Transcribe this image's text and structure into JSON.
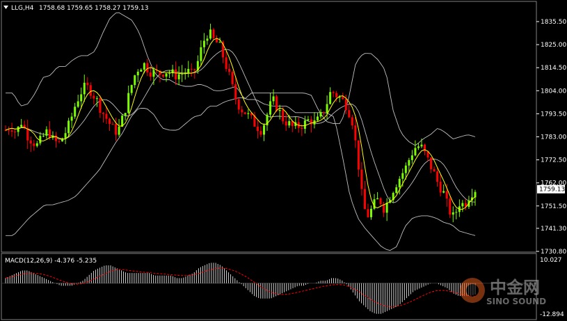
{
  "header": {
    "symbol_tf": "LLG,H4",
    "ohlc": "1758.68 1759.65 1758.27 1759.13"
  },
  "price_axis": {
    "ticks": [
      "1835.50",
      "1825.00",
      "1814.50",
      "1804.00",
      "1793.50",
      "1783.00",
      "1772.50",
      "1762.00",
      "1751.50",
      "1741.30",
      "1730.80"
    ],
    "current_price_label": "1759.13"
  },
  "macd": {
    "label": "MACD(12,26,9) -4.376 -5.235",
    "top_label": "10.027",
    "bottom_label": "-12.894"
  },
  "watermark": {
    "cn": "中金网",
    "en": "SINO SOUND"
  },
  "colors": {
    "background": "#000000",
    "bull": "#7CFC00",
    "bear": "#FF0000",
    "ma": "#FFFF00",
    "bollinger": "#C0C0C0",
    "macd_hist": "#FFFFFF",
    "macd_signal": "#FF0000",
    "current_price_bg": "#FFFFFF"
  },
  "chart_data": [
    {
      "type": "candlestick",
      "symbol": "LLG",
      "timeframe": "H4",
      "ylim": [
        1730.8,
        1840.0
      ],
      "current_price": 1759.13,
      "close_path": [
        1786,
        1788,
        1785,
        1790,
        1784,
        1781,
        1779,
        1783,
        1786,
        1781,
        1780,
        1784,
        1789,
        1797,
        1803,
        1806,
        1804,
        1800,
        1795,
        1791,
        1787,
        1785,
        1792,
        1801,
        1810,
        1815,
        1816,
        1813,
        1812,
        1812,
        1813,
        1812,
        1811,
        1812,
        1813,
        1811,
        1817,
        1826,
        1831,
        1827,
        1825,
        1818,
        1810,
        1801,
        1796,
        1794,
        1791,
        1788,
        1786,
        1793,
        1800,
        1796,
        1791,
        1789,
        1787,
        1788,
        1789,
        1791,
        1789,
        1792,
        1797,
        1804,
        1802,
        1800,
        1797,
        1790,
        1773,
        1751,
        1747,
        1752,
        1755,
        1750,
        1756,
        1761,
        1765,
        1769,
        1775,
        1779,
        1778,
        1773,
        1768,
        1762,
        1758,
        1750,
        1746,
        1753,
        1752,
        1757,
        1759.13
      ],
      "bollinger_upper_path": [
        1803,
        1803,
        1797,
        1798,
        1803,
        1810,
        1811,
        1815,
        1815,
        1818,
        1820,
        1820,
        1822,
        1830,
        1837,
        1840,
        1838,
        1836,
        1830,
        1820,
        1812,
        1809,
        1809,
        1807,
        1806,
        1806,
        1807,
        1806,
        1804,
        1804,
        1805,
        1806,
        1800,
        1803,
        1803,
        1803,
        1803,
        1803,
        1803,
        1803,
        1803,
        1802,
        1795,
        1790,
        1789,
        1789,
        1800,
        1817,
        1821,
        1821,
        1818,
        1813,
        1795,
        1785,
        1781,
        1779,
        1782,
        1784,
        1787,
        1785,
        1782,
        1783,
        1784,
        1783
      ],
      "bollinger_lower_path": [
        1738,
        1738,
        1742,
        1746,
        1749,
        1752,
        1752,
        1753,
        1754,
        1756,
        1760,
        1764,
        1768,
        1774,
        1780,
        1785,
        1792,
        1796,
        1796,
        1793,
        1787,
        1786,
        1786,
        1789,
        1792,
        1793,
        1797,
        1797,
        1799,
        1800,
        1801,
        1800,
        1800,
        1798,
        1797,
        1797,
        1797,
        1794,
        1794,
        1794,
        1794,
        1794,
        1792,
        1775,
        1756,
        1746,
        1741,
        1737,
        1733,
        1731,
        1733,
        1742,
        1746,
        1747,
        1747,
        1746,
        1744,
        1743,
        1740,
        1739,
        1738
      ]
    },
    {
      "type": "bar",
      "name": "MACD(12,26,9)",
      "ylim": [
        -12.894,
        10.027
      ],
      "macd_last": -4.376,
      "signal_last": -5.235,
      "macd_path": [
        2,
        3,
        4,
        5,
        5,
        4,
        3,
        2,
        1,
        0,
        -1,
        -1,
        -1,
        0,
        1,
        3,
        5,
        6,
        7,
        7,
        6,
        5,
        4,
        4,
        4,
        4,
        4,
        3,
        3,
        3,
        3,
        2,
        2,
        3,
        4,
        6,
        7,
        8,
        8,
        7,
        5,
        3,
        1,
        -1,
        -3,
        -5,
        -6,
        -6,
        -6,
        -5,
        -4,
        -3,
        -2,
        -1,
        -1,
        0,
        0,
        1,
        1,
        2,
        2,
        1,
        -1,
        -4,
        -7,
        -9,
        -11,
        -12,
        -12,
        -11,
        -10,
        -9,
        -7,
        -5,
        -3,
        -2,
        -1,
        0,
        0,
        -1,
        -2,
        -4,
        -5,
        -5,
        -5,
        -4.4
      ],
      "signal_path": [
        2,
        2.5,
        3,
        3.5,
        4,
        4,
        3.8,
        3.4,
        2.8,
        2,
        1.2,
        0.4,
        -0.2,
        -0.4,
        -0.2,
        0.5,
        1.5,
        2.5,
        3.5,
        4.5,
        5.2,
        5.4,
        5.2,
        4.9,
        4.6,
        4.4,
        4.2,
        4,
        3.8,
        3.6,
        3.4,
        3.2,
        3,
        3,
        3.2,
        3.6,
        4.2,
        5,
        5.6,
        5.9,
        5.9,
        5.5,
        4.8,
        3.8,
        2.6,
        1.2,
        -0.3,
        -1.7,
        -2.9,
        -3.8,
        -4.3,
        -4.4,
        -4.2,
        -3.8,
        -3.3,
        -2.8,
        -2.3,
        -1.8,
        -1.3,
        -0.9,
        -0.6,
        -0.5,
        -0.7,
        -1.3,
        -2.4,
        -3.7,
        -5.1,
        -6.5,
        -7.7,
        -8.6,
        -9.1,
        -9.2,
        -8.9,
        -8.3,
        -7.4,
        -6.4,
        -5.3,
        -4.3,
        -3.4,
        -2.9,
        -2.8,
        -3,
        -3.5,
        -4.1,
        -4.6,
        -5,
        -5.235
      ]
    }
  ]
}
